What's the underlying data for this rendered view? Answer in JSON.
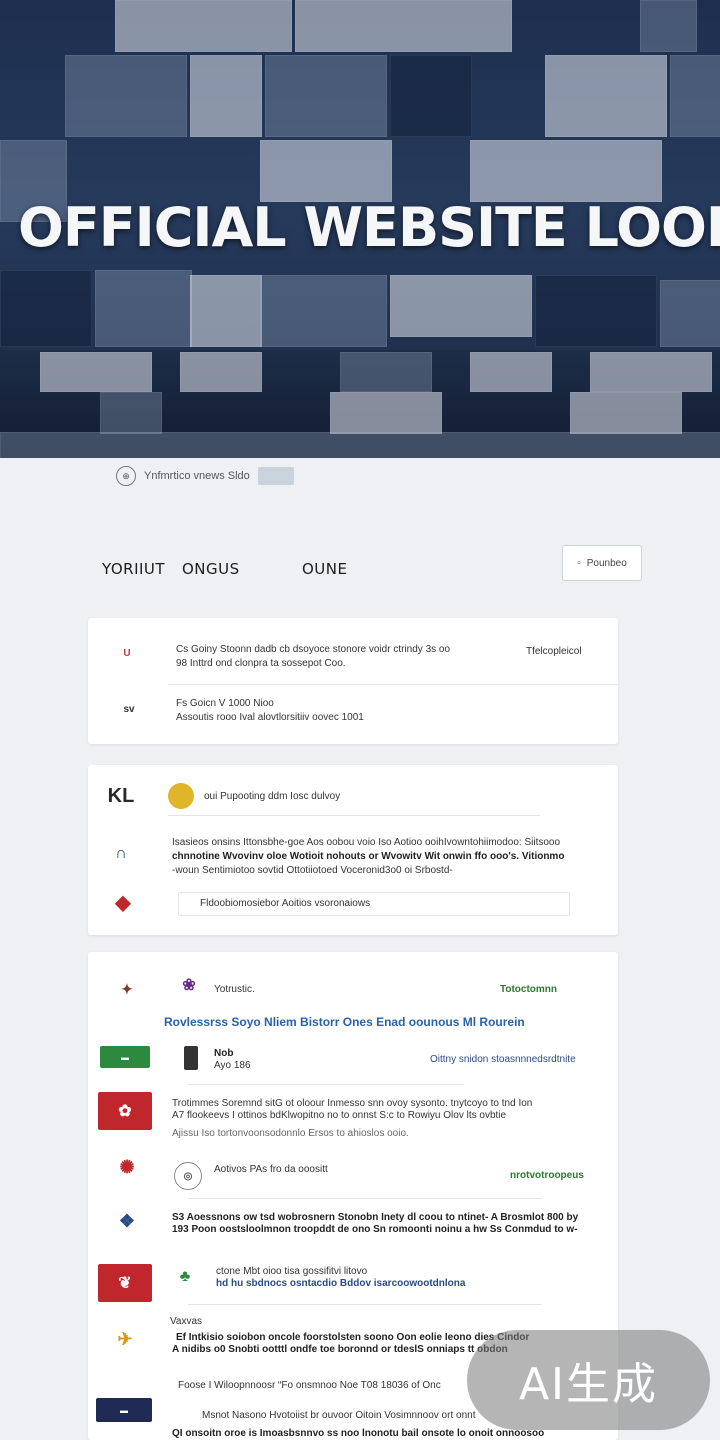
{
  "hero": {
    "title": "OFFICIAL WEBSITE LOOKUP"
  },
  "search": {
    "logo_text": "⊕",
    "text": "Ynfmrtico vnews Sldo"
  },
  "tabs": [
    "YORIIUT",
    "ONGUS",
    "OUNE"
  ],
  "filter": {
    "label": "Pounbeo",
    "icon": "filter-icon"
  },
  "card1": {
    "rows": [
      {
        "line1": "Cs Goiny Stoonn dadb cb dsoyoce stonore voidr ctrindy 3s oo",
        "line2": "98 Inttrd ond clonpra ta sossepot Coo.",
        "right": "Tfelcopleicol",
        "logo_text": "U",
        "logo_color": "#c23a3a"
      },
      {
        "line1": "Fs Goicn V 1000 Nioo",
        "line2": "Assoutis rooo Ival alovtlorsitiiv oovec 1001",
        "right": "",
        "logo_text": "sv",
        "logo_color": "#333333"
      }
    ]
  },
  "card2": {
    "header": "oui Pupooting ddm  Iosc dulvoy",
    "body1": "Isasieos onsins Ittonsbhe-goe Aos oobou voio Iso  Aotioo ooihIvowntohiimodoo: Siitsooo",
    "body2": "chnnotine Wvovinv oloe  Wotioit nohouts or Wvowitv  Wit onwin ffo ooo's. Vitionmo",
    "body3": "-woun Sentimiotoo sovtid  Ottotiiotoed Voceronid3o0 oi  Srbostd-",
    "footer": "Fldoobiomosiebor  Aoitios  vsoronaiows",
    "logos": [
      "KL",
      "∩",
      "◆"
    ]
  },
  "card3": {
    "title": "Rovlessrss Soyo Nliem Bistorr  Ones Enad oounous Ml Rourein",
    "brand": "Yotrustic.",
    "tagline": "Totoctomnn",
    "rows": [
      {
        "line1": "Nob",
        "line2": "Ayo 186",
        "right": "Oittny snidon stoasnnnedsrdtnite"
      },
      {
        "line1": "Trotimmes Soremnd sitG ot oloour Inmesso snn ovoy sysonto. tnytcoyo to tnd Ion",
        "line2": "A7 flookeevs I ottinos bdKlwopitno no to onnst S:c to Rowiyu Olov lts ovbtie",
        "line3": "Ajissu Iso tortonvoonsodonnlo Ersos to  ahioslos ooio."
      },
      {
        "line1": "Aotivos  PAs fro da ooositt",
        "right": "nrotvotroopeus"
      },
      {
        "line1": "S3 Aoessnons ow tsd wobrosnern Stonobn Inety dl coou to ntinet- A Brosmlot  800 by",
        "line2": "193 Poon oostsloolmnon troopddt de ono Sn romoonti noinu  a hw  Ss  Conmdud to w-"
      },
      {
        "line1": "ctone  Mbt oioo tisa gossifitvi litovo",
        "line2": "hd hu sbdnocs osntacdio Bddov isarcoowootdnlona"
      },
      {
        "line1": "Vaxvas"
      },
      {
        "line1": "Ef Intkisio soiobon oncole foorstolsten soono  Oon eolie Ieono dies  Cindor",
        "line2": "A nidibs o0  Snobti  ootttl ondfe toe boronnd or tdeslS onniaps tt obdon"
      },
      {
        "line1": "Foose I   Wiloopnnoosr   “Fo onsmnoo   Noe  T08  18036  of  Onc"
      },
      {
        "line1": "Msnot Nasono  Hvotoiist br ouvoor  Oitoin Vosimnnoov  ort onnt"
      },
      {
        "line1": "QI onsoitn oroe is Imoasbsnnvo ss noo lnonotu  bail onsote lo onoit onnoosoo"
      }
    ]
  },
  "badge": {
    "text": "AI生成"
  }
}
